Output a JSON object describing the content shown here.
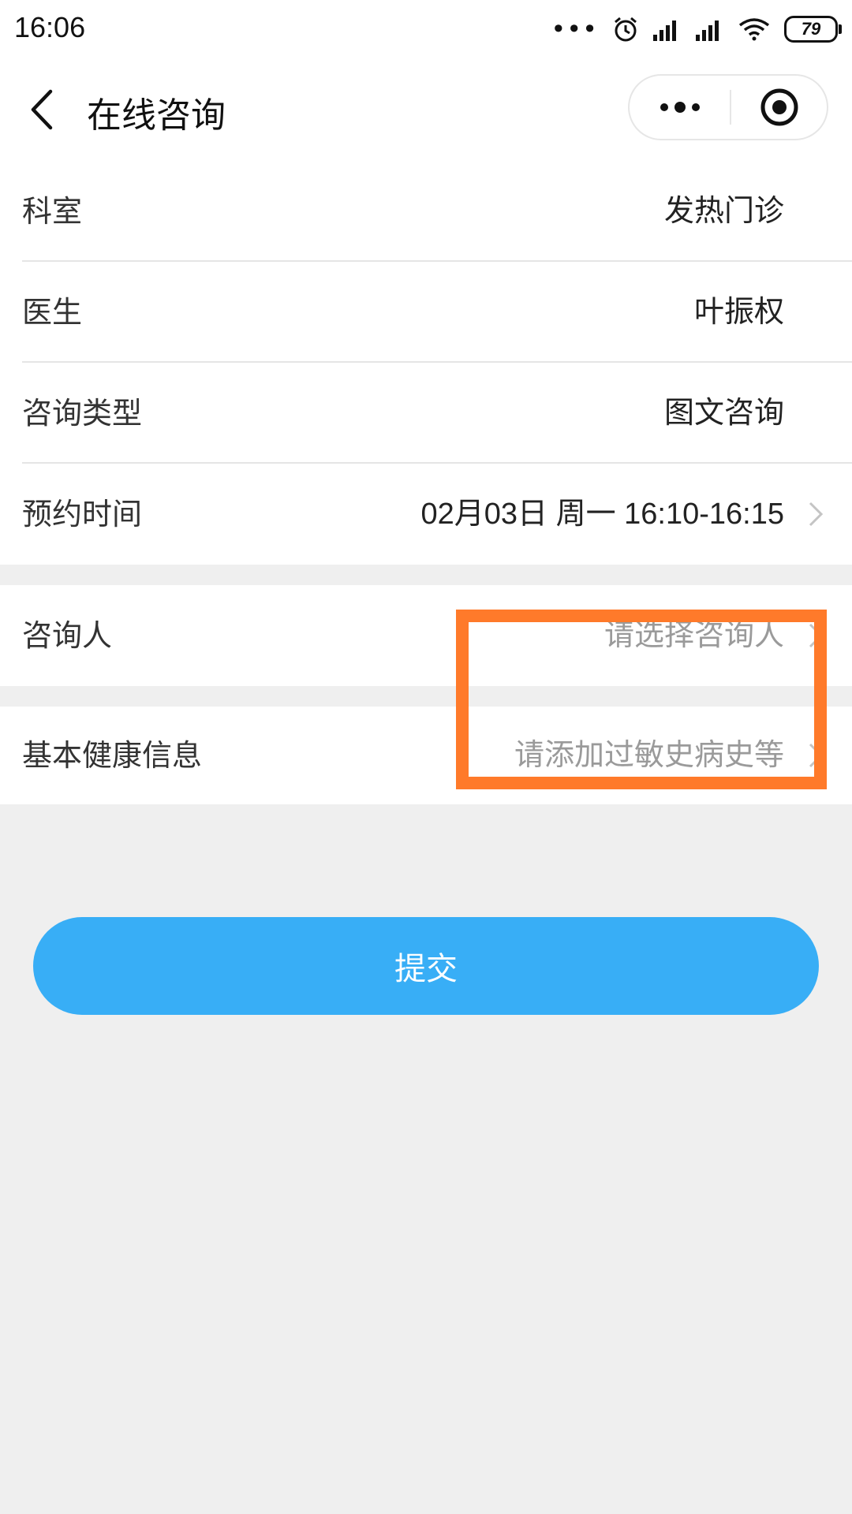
{
  "status_bar": {
    "time": "16:06",
    "dots": "•••",
    "battery": "79"
  },
  "nav": {
    "title": "在线咨询"
  },
  "form": {
    "department_label": "科室",
    "department_value": "发热门诊",
    "doctor_label": "医生",
    "doctor_value": "叶振权",
    "consult_type_label": "咨询类型",
    "consult_type_value": "图文咨询",
    "appointment_label": "预约时间",
    "appointment_value": "02月03日 周一 16:10-16:15",
    "consultant_label": "咨询人",
    "consultant_placeholder": "请选择咨询人",
    "health_label": "基本健康信息",
    "health_placeholder": "请添加过敏史病史等"
  },
  "submit_label": "提交",
  "colors": {
    "accent": "#38aef6",
    "highlight": "#ff7a2a",
    "background": "#efefef"
  }
}
